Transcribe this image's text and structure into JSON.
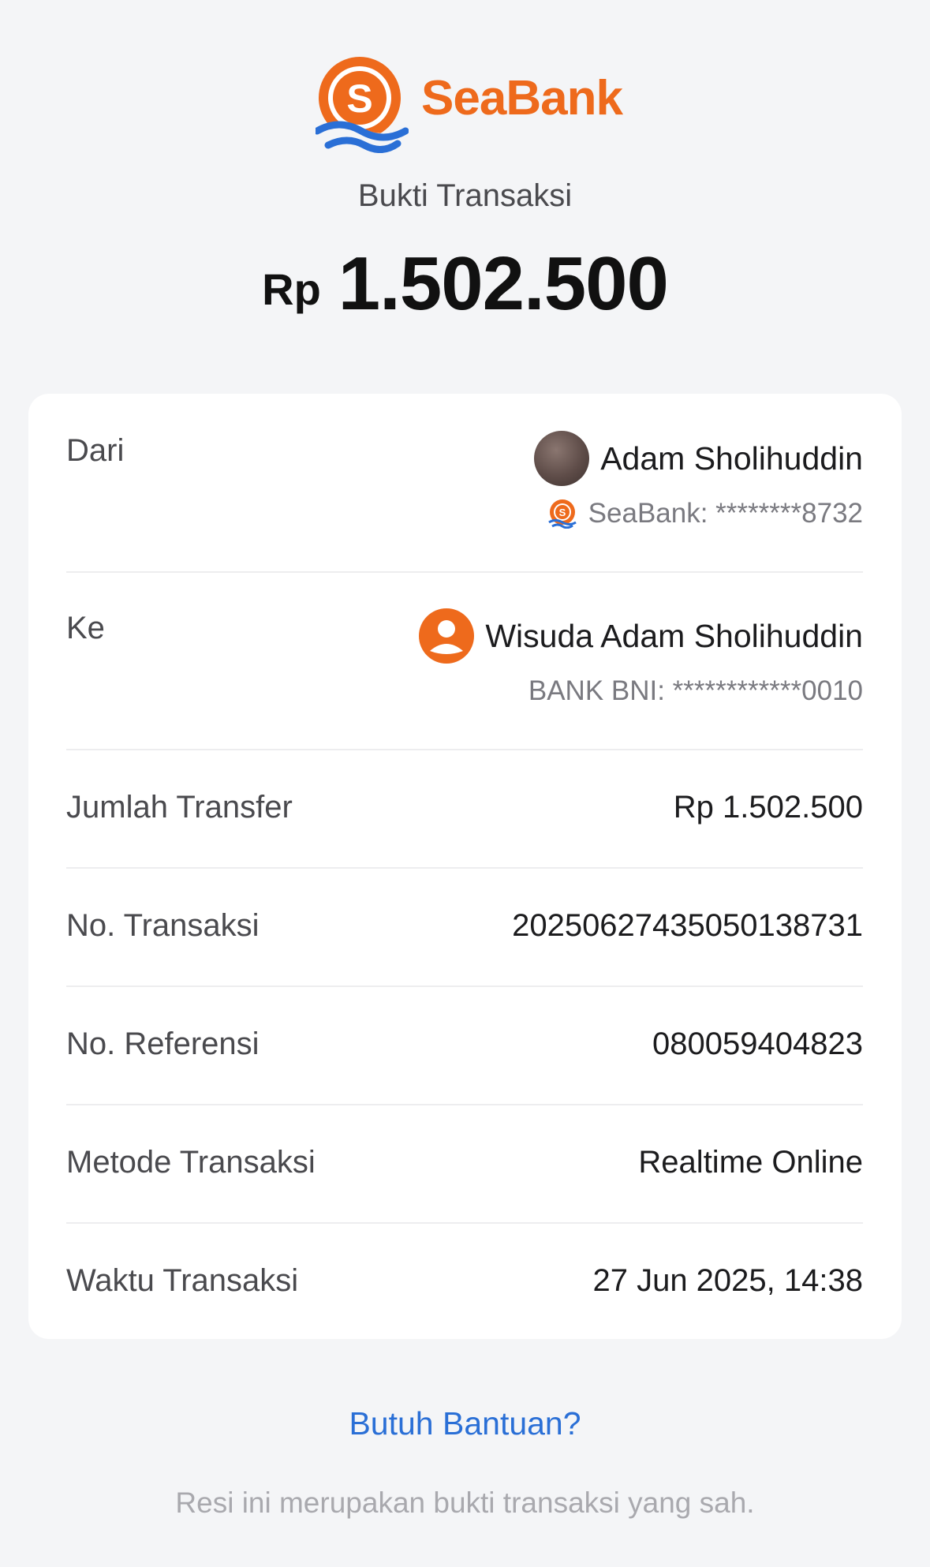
{
  "brand": {
    "name": "SeaBank",
    "logo_letter": "S",
    "accent_color": "#ee6a1c",
    "wave_color": "#2a6fd6"
  },
  "receipt": {
    "title": "Bukti Transaksi",
    "currency": "Rp",
    "amount": "1.502.500"
  },
  "from": {
    "label": "Dari",
    "name": "Adam Sholihuddin",
    "bank": "SeaBank: ********8732",
    "avatar_icon": "profile-photo"
  },
  "to": {
    "label": "Ke",
    "name": "Wisuda Adam Sholihuddin",
    "bank": "BANK BNI: ************0010",
    "avatar_icon": "user-icon"
  },
  "details": [
    {
      "label": "Jumlah Transfer",
      "value": "Rp 1.502.500"
    },
    {
      "label": "No. Transaksi",
      "value": "20250627435050138731"
    },
    {
      "label": "No. Referensi",
      "value": "080059404823"
    },
    {
      "label": "Metode Transaksi",
      "value": "Realtime Online"
    },
    {
      "label": "Waktu Transaksi",
      "value": "27 Jun 2025, 14:38"
    }
  ],
  "help_link": "Butuh Bantuan?",
  "footer_note": "Resi ini merupakan bukti transaksi yang sah."
}
